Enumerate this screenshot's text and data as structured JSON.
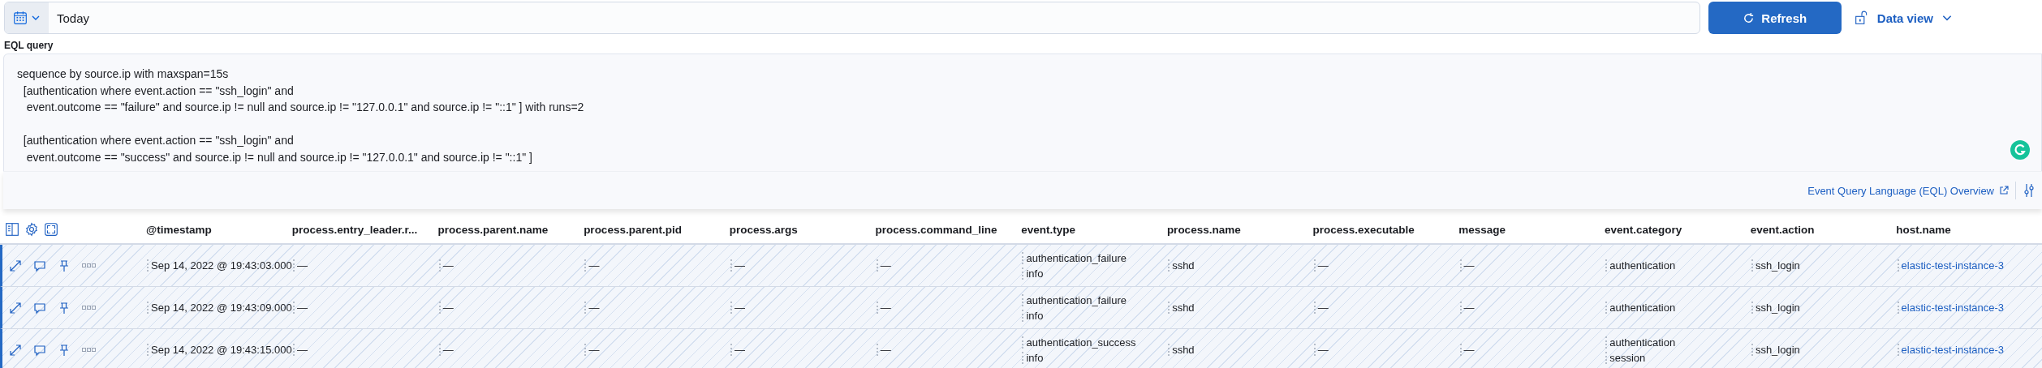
{
  "date_picker": {
    "value": "Today"
  },
  "refresh_button": {
    "label": "Refresh"
  },
  "data_view": {
    "label": "Data view"
  },
  "query": {
    "label": "EQL query",
    "value": "sequence by source.ip with maxspan=15s\n  [authentication where event.action == \"ssh_login\" and\n   event.outcome == \"failure\" and source.ip != null and source.ip != \"127.0.0.1\" and source.ip != \"::1\" ] with runs=2\n\n  [authentication where event.action == \"ssh_login\" and\n   event.outcome == \"success\" and source.ip != null and source.ip != \"127.0.0.1\" and source.ip != \"::1\" ]",
    "help_link": "Event Query Language (EQL) Overview"
  },
  "table": {
    "columns": [
      {
        "label": "@timestamp",
        "kind": "text"
      },
      {
        "label": "process.entry_leader.r...",
        "kind": "text"
      },
      {
        "label": "process.parent.name",
        "kind": "text"
      },
      {
        "label": "process.parent.pid",
        "kind": "text"
      },
      {
        "label": "process.args",
        "kind": "text"
      },
      {
        "label": "process.command_line",
        "kind": "text"
      },
      {
        "label": "event.type",
        "kind": "text"
      },
      {
        "label": "process.name",
        "kind": "text"
      },
      {
        "label": "process.executable",
        "kind": "text"
      },
      {
        "label": "message",
        "kind": "text"
      },
      {
        "label": "event.category",
        "kind": "text"
      },
      {
        "label": "event.action",
        "kind": "text"
      },
      {
        "label": "host.name",
        "kind": "link"
      }
    ],
    "rows": [
      {
        "cells": [
          [
            "Sep 14, 2022 @ 19:43:03.000"
          ],
          [
            "—"
          ],
          [
            "—"
          ],
          [
            "—"
          ],
          [
            "—"
          ],
          [
            "—"
          ],
          [
            "authentication_failure",
            "info"
          ],
          [
            "sshd"
          ],
          [
            "—"
          ],
          [
            "—"
          ],
          [
            "authentication"
          ],
          [
            "ssh_login"
          ],
          [
            "elastic-test-instance-3"
          ]
        ]
      },
      {
        "cells": [
          [
            "Sep 14, 2022 @ 19:43:09.000"
          ],
          [
            "—"
          ],
          [
            "—"
          ],
          [
            "—"
          ],
          [
            "—"
          ],
          [
            "—"
          ],
          [
            "authentication_failure",
            "info"
          ],
          [
            "sshd"
          ],
          [
            "—"
          ],
          [
            "—"
          ],
          [
            "authentication"
          ],
          [
            "ssh_login"
          ],
          [
            "elastic-test-instance-3"
          ]
        ]
      },
      {
        "cells": [
          [
            "Sep 14, 2022 @ 19:43:15.000"
          ],
          [
            "—"
          ],
          [
            "—"
          ],
          [
            "—"
          ],
          [
            "—"
          ],
          [
            "—"
          ],
          [
            "authentication_success",
            "info"
          ],
          [
            "sshd"
          ],
          [
            "—"
          ],
          [
            "—"
          ],
          [
            "authentication",
            "session"
          ],
          [
            "ssh_login"
          ],
          [
            "elastic-test-instance-3"
          ]
        ]
      }
    ]
  }
}
